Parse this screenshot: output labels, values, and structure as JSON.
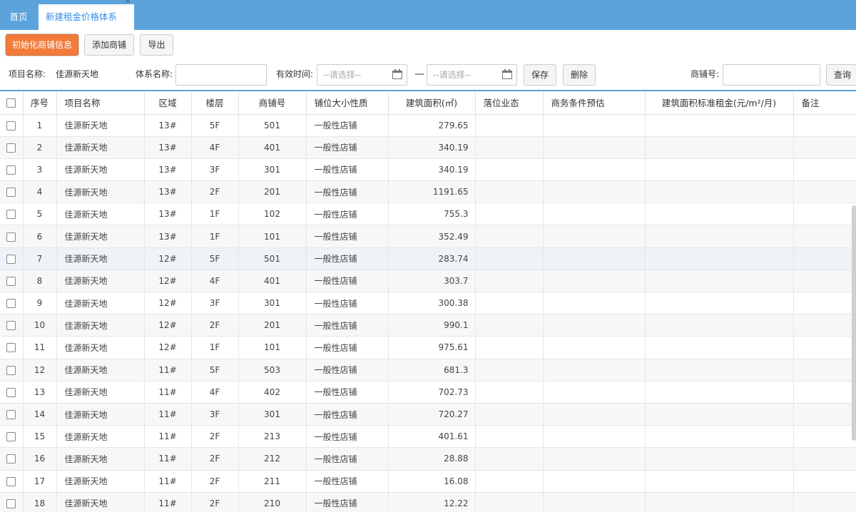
{
  "tabs": {
    "home": "首页",
    "active": "新建租金价格体系",
    "close": "×"
  },
  "toolbar": {
    "init": "初始化商铺信息",
    "add": "添加商铺",
    "export": "导出"
  },
  "filter": {
    "project_label": "项目名称:",
    "project_value": "佳源新天地",
    "system_label": "体系名称:",
    "valid_label": "有效时间:",
    "date_placeholder": "--请选择--",
    "dash": "—",
    "save": "保存",
    "delete": "删除",
    "shop_label": "商铺号:",
    "query": "查询"
  },
  "table": {
    "headers": [
      "序号",
      "项目名称",
      "区域",
      "楼层",
      "商铺号",
      "铺位大小性质",
      "建筑面积(㎡)",
      "落位业态",
      "商务条件预估",
      "建筑面积标准租金(元/m²/月)",
      "备注"
    ],
    "rows": [
      [
        "1",
        "佳源新天地",
        "13#",
        "5F",
        "501",
        "一般性店铺",
        "279.65"
      ],
      [
        "2",
        "佳源新天地",
        "13#",
        "4F",
        "401",
        "一般性店铺",
        "340.19"
      ],
      [
        "3",
        "佳源新天地",
        "13#",
        "3F",
        "301",
        "一般性店铺",
        "340.19"
      ],
      [
        "4",
        "佳源新天地",
        "13#",
        "2F",
        "201",
        "一般性店铺",
        "1191.65"
      ],
      [
        "5",
        "佳源新天地",
        "13#",
        "1F",
        "102",
        "一般性店铺",
        "755.3"
      ],
      [
        "6",
        "佳源新天地",
        "13#",
        "1F",
        "101",
        "一般性店铺",
        "352.49"
      ],
      [
        "7",
        "佳源新天地",
        "12#",
        "5F",
        "501",
        "一般性店铺",
        "283.74"
      ],
      [
        "8",
        "佳源新天地",
        "12#",
        "4F",
        "401",
        "一般性店铺",
        "303.7"
      ],
      [
        "9",
        "佳源新天地",
        "12#",
        "3F",
        "301",
        "一般性店铺",
        "300.38"
      ],
      [
        "10",
        "佳源新天地",
        "12#",
        "2F",
        "201",
        "一般性店铺",
        "990.1"
      ],
      [
        "11",
        "佳源新天地",
        "12#",
        "1F",
        "101",
        "一般性店铺",
        "975.61"
      ],
      [
        "12",
        "佳源新天地",
        "11#",
        "5F",
        "503",
        "一般性店铺",
        "681.3"
      ],
      [
        "13",
        "佳源新天地",
        "11#",
        "4F",
        "402",
        "一般性店铺",
        "702.73"
      ],
      [
        "14",
        "佳源新天地",
        "11#",
        "3F",
        "301",
        "一般性店铺",
        "720.27"
      ],
      [
        "15",
        "佳源新天地",
        "11#",
        "2F",
        "213",
        "一般性店铺",
        "401.61"
      ],
      [
        "16",
        "佳源新天地",
        "11#",
        "2F",
        "212",
        "一般性店铺",
        "28.88"
      ],
      [
        "17",
        "佳源新天地",
        "11#",
        "2F",
        "211",
        "一般性店铺",
        "16.08"
      ],
      [
        "18",
        "佳源新天地",
        "11#",
        "2F",
        "210",
        "一般性店铺",
        "12.22"
      ]
    ]
  },
  "colors": {
    "tab_bar": "#5ca3dc",
    "primary_button": "#f37b3a",
    "active_tab_text": "#3a8ee6"
  }
}
